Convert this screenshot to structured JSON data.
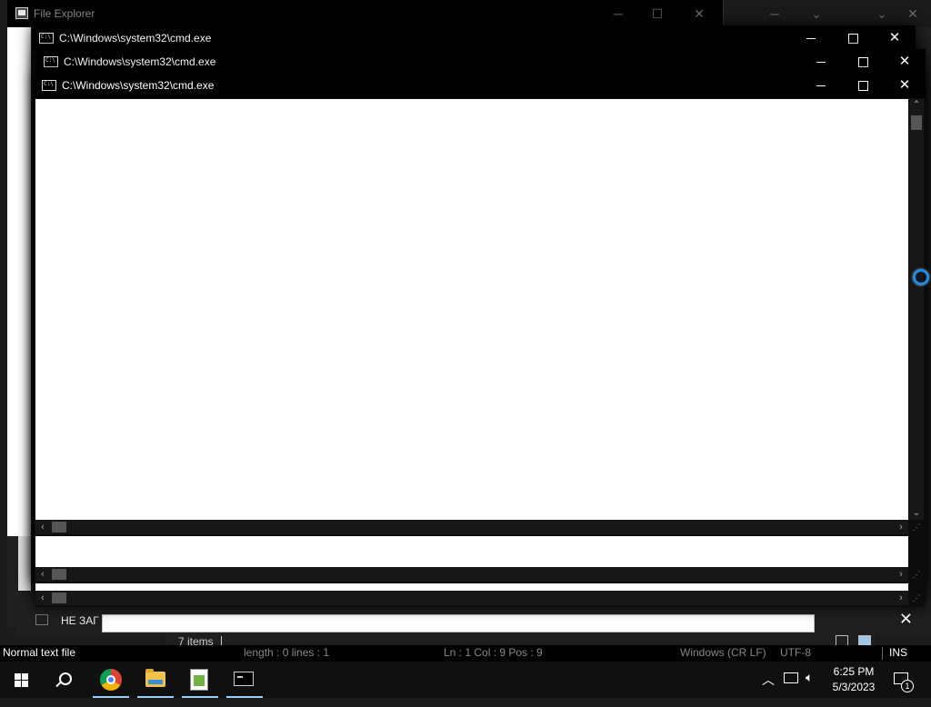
{
  "file_explorer": {
    "title": "File Explorer",
    "items_count": "7 items"
  },
  "cmd_windows": [
    {
      "title": "C:\\Windows\\system32\\cmd.exe"
    },
    {
      "title": "C:\\Windows\\system32\\cmd.exe"
    },
    {
      "title": "C:\\Windows\\system32\\cmd.exe"
    }
  ],
  "controls": {
    "minimize": "",
    "maximize": "",
    "close": "✕"
  },
  "notepad_tab": {
    "title": "НЕ ЗАГ",
    "close": "✕"
  },
  "notepad_status": {
    "file_type": "Normal text file",
    "length_lines": "length : 0    lines : 1",
    "position": "Ln : 1    Col : 9    Pos : 9",
    "eol": "Windows (CR LF)",
    "encoding": "UTF-8",
    "mode": "INS"
  },
  "taskbar": {
    "apps": [
      "start",
      "search",
      "chrome",
      "file-explorer",
      "notepad-plus-plus",
      "command-prompt"
    ],
    "time": "6:25 PM",
    "date": "5/3/2023",
    "notification_count": "1"
  },
  "colors": {
    "accent": "#1e8ce8",
    "titlebar": "#000000",
    "content": "#ffffff"
  }
}
